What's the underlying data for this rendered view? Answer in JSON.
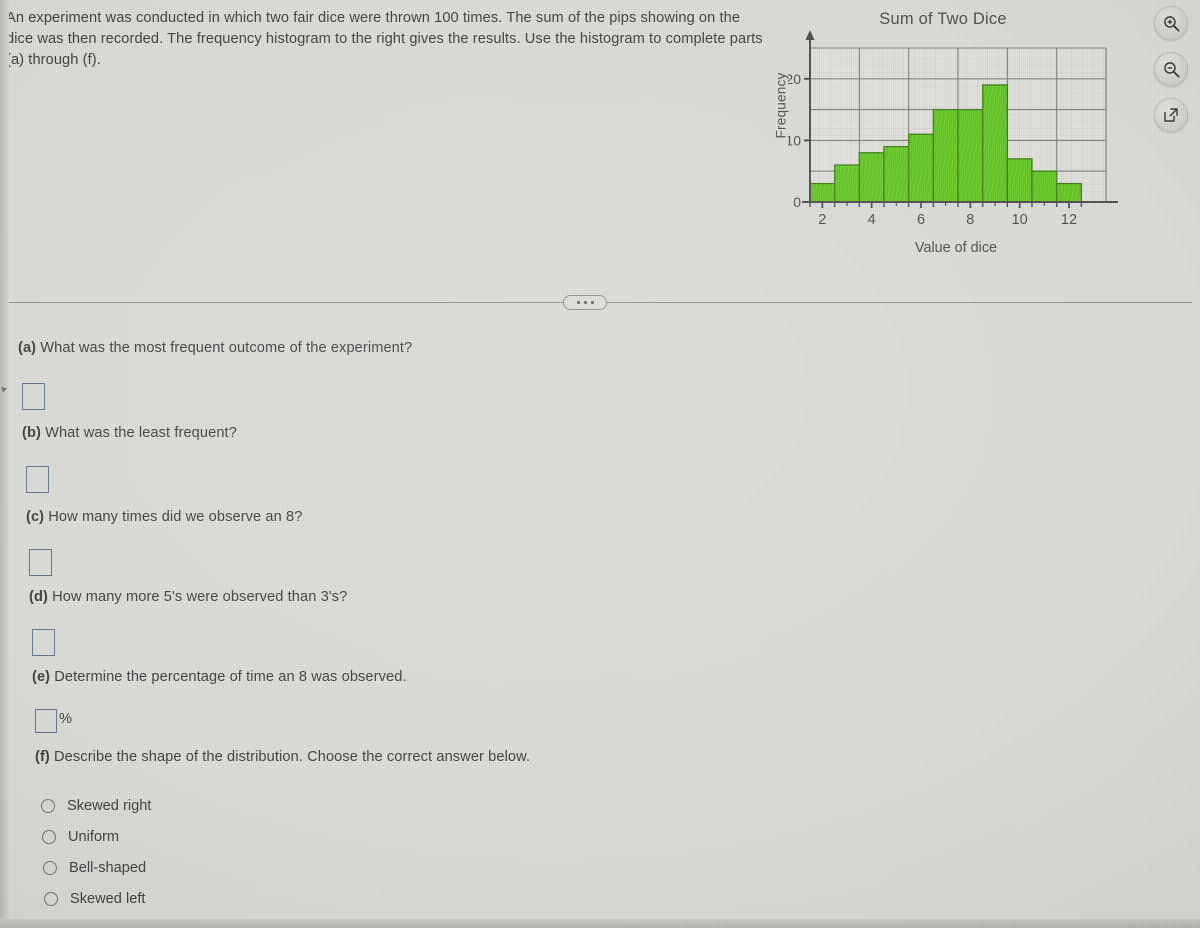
{
  "problem": {
    "statement": "An experiment was conducted in which two fair dice were thrown 100 times. The sum of the pips showing on the dice was then recorded. The frequency histogram to the right gives the results. Use the histogram to complete parts (a) through (f)."
  },
  "toolbar": {
    "buttons": [
      {
        "name": "zoom-in-button",
        "icon": "magnifier-plus-icon",
        "label": "Zoom in"
      },
      {
        "name": "zoom-out-button",
        "icon": "magnifier-minus-icon",
        "label": "Zoom out"
      },
      {
        "name": "open-in-new-window-button",
        "icon": "external-link-icon",
        "label": "Open in new window"
      }
    ]
  },
  "divider": {
    "more_label": "..."
  },
  "questions": [
    {
      "id": "a",
      "prefix": "(a)",
      "text": " What was the most frequent outcome of the experiment?",
      "answer": "",
      "placeholder": "",
      "suffix": ""
    },
    {
      "id": "b",
      "prefix": "(b)",
      "text": " What was the least frequent?",
      "answer": "",
      "placeholder": "",
      "suffix": ""
    },
    {
      "id": "c",
      "prefix": "(c)",
      "text": " How many times did we observe an 8?",
      "answer": "",
      "placeholder": "",
      "suffix": ""
    },
    {
      "id": "d",
      "prefix": "(d)",
      "text": " How many more 5's were observed than 3's?",
      "answer": "",
      "placeholder": "",
      "suffix": ""
    },
    {
      "id": "e",
      "prefix": "(e)",
      "text": " Determine the percentage of time an 8 was observed.",
      "answer": "",
      "placeholder": "",
      "suffix": "%"
    },
    {
      "id": "f",
      "prefix": "(f)",
      "text": " Describe the shape of the distribution. Choose the correct answer below.",
      "answer": null,
      "placeholder": "",
      "suffix": ""
    }
  ],
  "choices": [
    {
      "id": "skewed-right",
      "label": "Skewed right",
      "selected": false
    },
    {
      "id": "uniform",
      "label": "Uniform",
      "selected": false
    },
    {
      "id": "bell-shaped",
      "label": "Bell-shaped",
      "selected": false
    },
    {
      "id": "skewed-left",
      "label": "Skewed left",
      "selected": false
    }
  ],
  "colors": {
    "bar_fill": "#5cc31a",
    "bar_stroke": "#3c7d14",
    "grid_major": "#7e7e7a",
    "grid_minor": "#c0c0bb",
    "axis": "#4a4a4a",
    "plot_bg": "#dededa",
    "page_bg": "#d9d9d5",
    "answer_box_border": "#5f7190"
  },
  "chart_data": {
    "type": "bar",
    "title": "Sum of Two Dice",
    "xlabel": "Value of dice",
    "ylabel": "Frequency",
    "categories": [
      2,
      3,
      4,
      5,
      6,
      7,
      8,
      9,
      10,
      11,
      12
    ],
    "values": [
      3,
      6,
      8,
      9,
      11,
      15,
      15,
      19,
      7,
      5,
      3
    ],
    "xlim": [
      1.5,
      13.5
    ],
    "ylim": [
      0,
      25
    ],
    "x_ticks_labeled": [
      2,
      4,
      6,
      8,
      10,
      12
    ],
    "y_ticks_labeled": [
      0,
      10,
      20
    ],
    "y_gridlines": [
      0,
      5,
      10,
      15,
      20,
      25
    ],
    "grid": true,
    "minor_grid": true,
    "legend": "none",
    "total": 100
  }
}
